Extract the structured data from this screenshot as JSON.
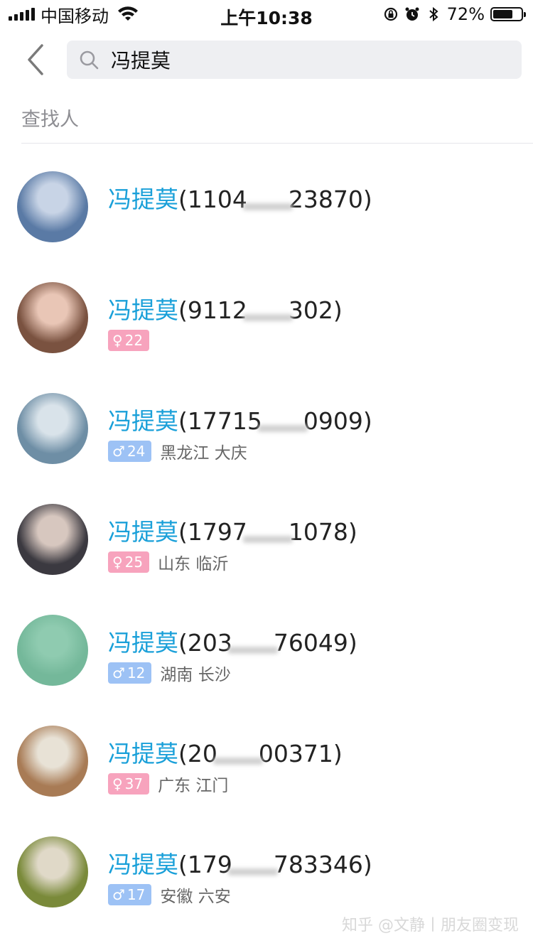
{
  "status_bar": {
    "carrier": "中国移动",
    "time": "上午10:38",
    "battery_pct": "72%",
    "battery_level": 0.72
  },
  "search": {
    "value": "冯提莫",
    "placeholder": ""
  },
  "section_title": "查找人",
  "results": [
    {
      "name": "冯提莫",
      "id": "(1104",
      "id_rest": "23870)",
      "badge": "",
      "gender": "",
      "age": "",
      "location": "",
      "avatar_colors": [
        "#5a7aa5",
        "#c8d4e6"
      ]
    },
    {
      "name": "冯提莫",
      "id": "(9112",
      "id_rest": "302)",
      "badge": "♀",
      "gender": "female",
      "age": "22",
      "location": "",
      "avatar_colors": [
        "#7a5240",
        "#e9c6b6"
      ]
    },
    {
      "name": "冯提莫",
      "id": "(17715",
      "id_rest": "0909)",
      "badge": "♂",
      "gender": "male",
      "age": "24",
      "location": "黑龙江 大庆",
      "avatar_colors": [
        "#6e8ea5",
        "#d9e3ea"
      ]
    },
    {
      "name": "冯提莫",
      "id": "(1797",
      "id_rest": "1078)",
      "badge": "♀",
      "gender": "female",
      "age": "25",
      "location": "山东 临沂",
      "avatar_colors": [
        "#3b3940",
        "#d7c7bf"
      ]
    },
    {
      "name": "冯提莫",
      "id": "(203",
      "id_rest": "76049)",
      "badge": "♂",
      "gender": "male",
      "age": "12",
      "location": "湖南 长沙",
      "avatar_colors": [
        "#74b89a",
        "#8fcbb0"
      ]
    },
    {
      "name": "冯提莫",
      "id": "(20",
      "id_rest": "00371)",
      "badge": "♀",
      "gender": "female",
      "age": "37",
      "location": "广东 江门",
      "avatar_colors": [
        "#a87b55",
        "#e8e2d6"
      ]
    },
    {
      "name": "冯提莫",
      "id": "(179",
      "id_rest": "783346)",
      "badge": "♂",
      "gender": "male",
      "age": "17",
      "location": "安徽 六安",
      "avatar_colors": [
        "#7a8a3a",
        "#e0d9c8"
      ]
    }
  ],
  "watermark": "知乎 @文静丨朋友圈变现",
  "icons": {
    "back": "chevron-left-icon",
    "search": "search-icon",
    "wifi": "wifi-icon",
    "lock_rotation": "rotation-lock-icon",
    "alarm": "alarm-icon",
    "bluetooth": "bluetooth-icon",
    "battery": "battery-icon"
  },
  "colors": {
    "highlight": "#1aa0d9",
    "female_badge": "#f7a3bd",
    "male_badge": "#9dc2f5"
  }
}
